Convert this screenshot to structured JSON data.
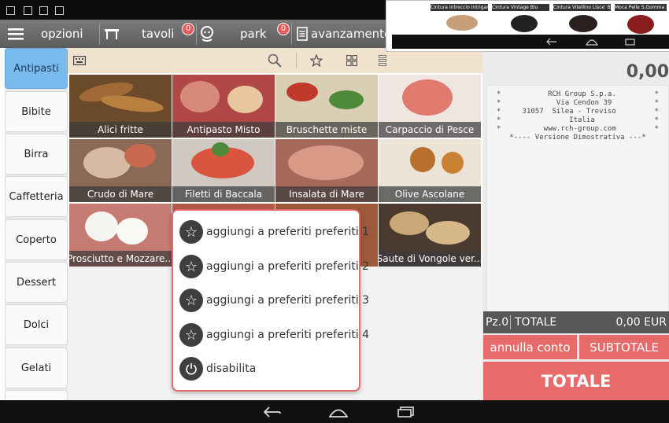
{
  "topbar": {
    "opzioni": "opzioni",
    "tavoli": "tavoli",
    "tavoli_count": "0",
    "park": "park",
    "park_count": "0",
    "avanzamento": "avanzamento"
  },
  "categories": [
    "Antipasti",
    "Bibite",
    "Birra",
    "Caffetteria",
    "Coperto",
    "Dessert",
    "Dolci",
    "Gelati"
  ],
  "products": [
    "Alici fritte",
    "Antipasto Misto",
    "Bruschette miste",
    "Carpaccio di Pesce",
    "Crudo di Mare",
    "Filetti di Baccala",
    "Insalata di Mare",
    "Olive Ascolane",
    "Prosciutto e Mozzare...",
    "",
    "",
    "Saute di Vongole ver..."
  ],
  "popup_menu": {
    "items": [
      "aggiungi a preferiti preferiti 1",
      "aggiungi a preferiti preferiti 2",
      "aggiungi a preferiti preferiti 3",
      "aggiungi a preferiti preferiti 4"
    ],
    "disable": "disabilita"
  },
  "receipt": {
    "amount": "0,00",
    "lines": [
      "*           RCH Group S.p.a.         *",
      "*             Via Cendon 39          *",
      "*     31057  Silea - Treviso         *",
      "*                Italia              *",
      "*          www.rch-group.com         *",
      "*---- Versione Dimostrativa ---*"
    ]
  },
  "totals": {
    "pz": "Pz.0",
    "label": "TOTALE",
    "value": "0,00 EUR"
  },
  "buttons": {
    "annulla": "annulla conto",
    "subtotale": "SUBTOTALE",
    "totale": "TOTALE"
  },
  "overlay": {
    "thumbs": [
      "Cintura Intreccio Intrigante",
      "Cintura Vintage Blu",
      "Cintura Vitellino Lisce' Beige",
      "Moca Pelle S.Gomma - Sp"
    ]
  },
  "colors": {
    "accent": "#e86b6b",
    "sidebar_active": "#78b9ee",
    "toolbar": "#f0e2cc"
  }
}
